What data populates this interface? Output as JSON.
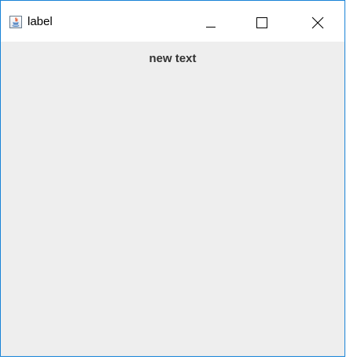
{
  "window": {
    "title": "label",
    "app_icon": "java-icon",
    "controls": {
      "minimize_icon": "minimize-icon",
      "maximize_icon": "maximize-icon",
      "close_icon": "close-icon"
    }
  },
  "content": {
    "label_text": "new text"
  },
  "colors": {
    "window_border": "#1883d7",
    "titlebar_bg": "#ffffff",
    "content_bg": "#eeeeee",
    "label_color": "#333333"
  }
}
